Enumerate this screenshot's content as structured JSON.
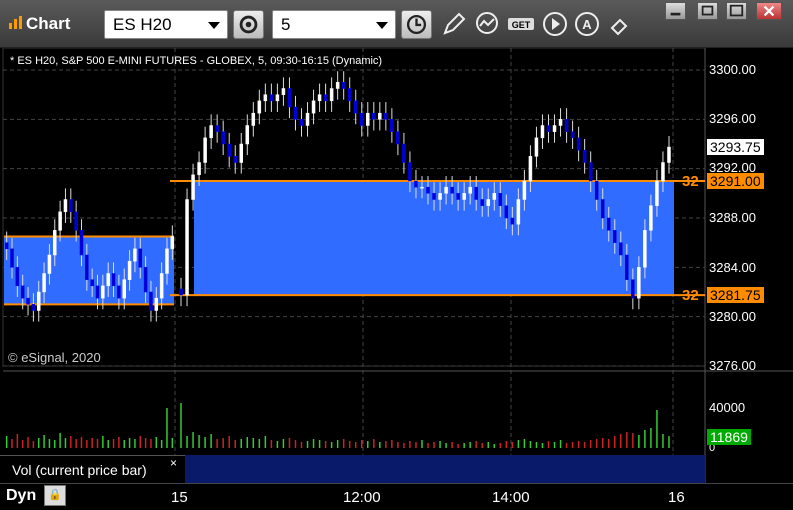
{
  "window": {
    "title": "Chart",
    "symbol_value": "ES H20",
    "interval_value": "5"
  },
  "chart_header": "* ES H20, S&P 500 E-MINI FUTURES - GLOBEX, 5, 09:30-16:15 (Dynamic)",
  "copyright": "© eSignal, 2020",
  "price_axis": [
    "3300.00",
    "3296.00",
    "3292.00",
    "3288.00",
    "3284.00",
    "3280.00",
    "3276.00"
  ],
  "current_price_tag": "3293.75",
  "level_tags": [
    {
      "num": "32",
      "price": "3291.00"
    },
    {
      "num": "32",
      "price": "3281.75"
    }
  ],
  "volume_axis": [
    "40000",
    "0"
  ],
  "volume_tag": "11869",
  "volume_label": "Vol (current price bar)",
  "volume_close": "×",
  "bottom": {
    "mode_label": "Dyn",
    "time_labels": [
      "15",
      "12:00",
      "14:00",
      "16"
    ]
  },
  "colors": {
    "band": "#2f6cff",
    "level_line": "#ff8c00",
    "up_candle": "#ffffff",
    "down_candle": "#0000cc",
    "vol_up": "#33cc33",
    "vol_down": "#cc2222",
    "volume_tag_bg": "#00aa00"
  },
  "chart_data": {
    "type": "candlestick",
    "title": "* ES H20, S&P 500 E-MINI FUTURES - GLOBEX, 5, 09:30-16:15 (Dynamic)",
    "ylim": [
      3275,
      3301.5
    ],
    "yticks": [
      3300,
      3296,
      3292,
      3288,
      3284,
      3280,
      3276
    ],
    "levels": [
      3291.0,
      3281.75
    ],
    "prev_day_band": [
      3281.0,
      3286.5
    ],
    "last_price": 3293.75,
    "volume_last": 11869,
    "volume_tick": 40000,
    "x_labels": [
      "15",
      "12:00",
      "14:00",
      "16"
    ],
    "closes_prev_session": [
      3285.5,
      3284,
      3282.5,
      3281.5,
      3281,
      3280.5,
      3282,
      3283.5,
      3285,
      3287,
      3288.5,
      3289.5,
      3288.5,
      3287,
      3285,
      3283,
      3282.5,
      3281.5,
      3282.5,
      3283.5,
      3282.5,
      3281.5,
      3283,
      3284.5,
      3285.5,
      3284,
      3282,
      3280.5,
      3281.5,
      3283.5,
      3285.5,
      3286.5
    ],
    "closes_today": [
      3281.75,
      3289.5,
      3291.5,
      3292.5,
      3294.5,
      3295.5,
      3295,
      3294,
      3293,
      3292.5,
      3294,
      3295.5,
      3296.5,
      3297.5,
      3298,
      3297.5,
      3298,
      3298.5,
      3297,
      3296,
      3295.5,
      3296.5,
      3297.5,
      3298,
      3297.5,
      3298.5,
      3299,
      3298.5,
      3297.5,
      3296.5,
      3295.5,
      3296.5,
      3296,
      3296.5,
      3296,
      3295,
      3294,
      3292.5,
      3291,
      3290.5,
      3290.5,
      3290,
      3289.5,
      3290,
      3290.5,
      3290,
      3289.5,
      3290,
      3290.5,
      3289.5,
      3289,
      3289.5,
      3290,
      3289,
      3288,
      3287.5,
      3289.5,
      3291,
      3293,
      3294.5,
      3295.5,
      3295,
      3295.5,
      3296,
      3295,
      3294.5,
      3293.5,
      3292.5,
      3291,
      3289.5,
      3288,
      3287,
      3286,
      3285,
      3283,
      3281.5,
      3284,
      3287,
      3289,
      3291,
      3292.5,
      3293.75
    ],
    "volume_prev_session": [
      12000,
      9000,
      14000,
      8000,
      11000,
      7000,
      10000,
      13000,
      9000,
      8000,
      15000,
      10000,
      12000,
      9000,
      11000,
      8000,
      10000,
      9000,
      12000,
      8000,
      9000,
      11000,
      8000,
      10000,
      9000,
      12000,
      10000,
      9000,
      11000,
      8000,
      40000,
      10000
    ],
    "volume_today": [
      45000,
      12000,
      16000,
      13000,
      11000,
      14000,
      9000,
      10000,
      12000,
      8000,
      9000,
      11000,
      10000,
      9000,
      12000,
      8000,
      7000,
      9000,
      10000,
      8000,
      6000,
      7000,
      9000,
      8000,
      7000,
      6000,
      8000,
      9000,
      7000,
      6000,
      8000,
      7000,
      9000,
      6000,
      7000,
      8000,
      6000,
      5000,
      7000,
      6000,
      8000,
      5000,
      6000,
      7000,
      5000,
      6000,
      4000,
      5000,
      6000,
      7000,
      5000,
      6000,
      4000,
      5000,
      7000,
      6000,
      8000,
      9000,
      7000,
      6000,
      5000,
      7000,
      6000,
      8000,
      5000,
      6000,
      7000,
      6000,
      8000,
      9000,
      10000,
      9000,
      12000,
      14000,
      16000,
      15000,
      13000,
      18000,
      20000,
      38000,
      14000,
      11869
    ]
  }
}
